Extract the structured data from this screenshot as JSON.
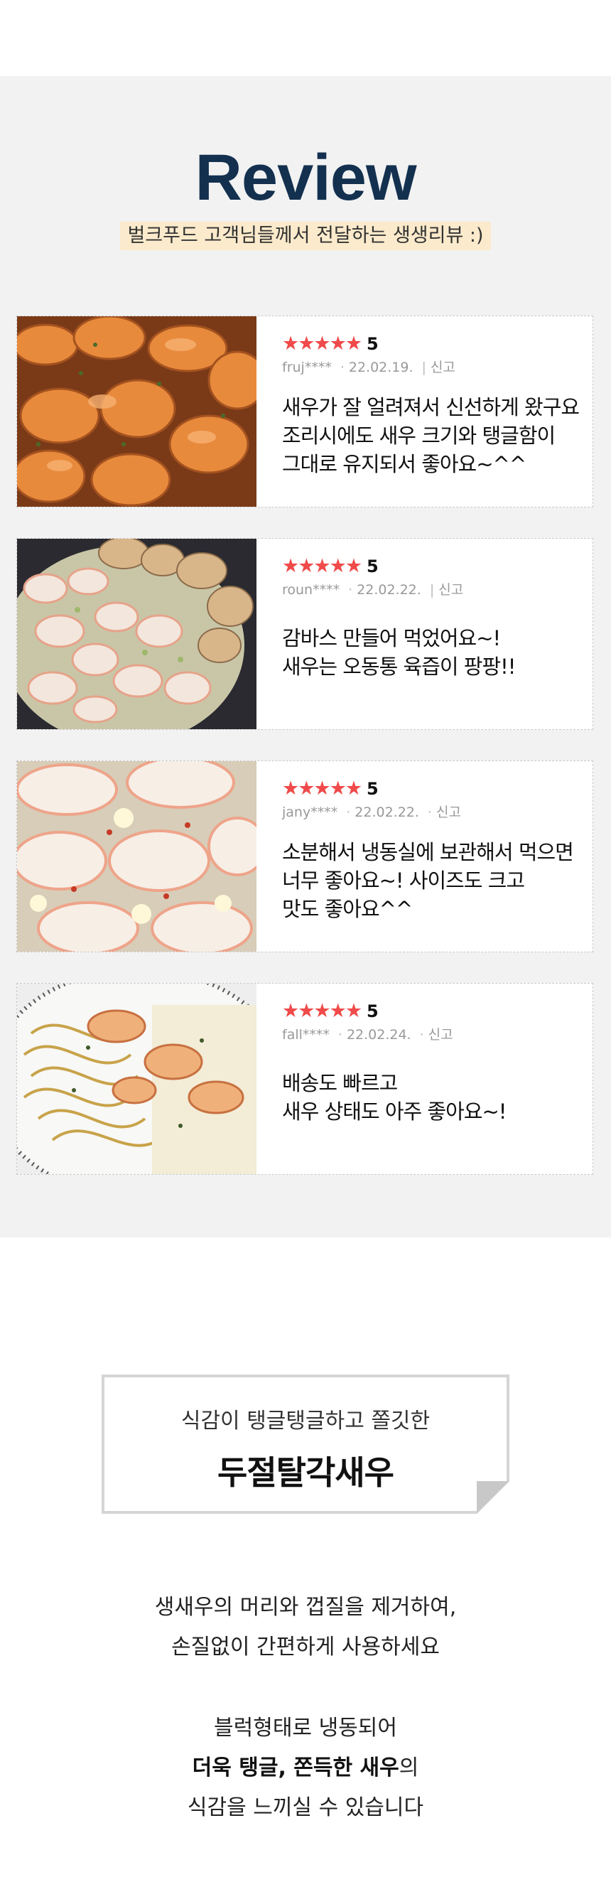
{
  "review": {
    "title": "Review",
    "subtitle": "벌크푸드 고객님들께서 전달하는 생생리뷰 :)",
    "items": [
      {
        "stars": "★★★★★",
        "rating": "5",
        "user": "fruj****",
        "date": "22.02.19.",
        "report": "신고",
        "lines": [
          "새우가 잘 얼려져서 신선하게 왔구요",
          "조리시에도 새우 크기와 탱글함이",
          "그대로 유지되서 좋아요~^^"
        ]
      },
      {
        "stars": "★★★★★",
        "rating": "5",
        "user": "roun****",
        "date": "22.02.22.",
        "report": "신고",
        "lines": [
          "감바스 만들어 먹었어요~!",
          "새우는 오동통 육즙이 팡팡!!"
        ]
      },
      {
        "stars": "★★★★★",
        "rating": "5",
        "user": "jany****",
        "date": "22.02.22.",
        "report": "신고",
        "lines": [
          "소분해서 냉동실에 보관해서 먹으면",
          "너무 좋아요~! 사이즈도 크고",
          "맛도 좋아요^^"
        ]
      },
      {
        "stars": "★★★★★",
        "rating": "5",
        "user": "fall****",
        "date": "22.02.24.",
        "report": "신고",
        "lines": [
          "배송도 빠르고",
          "새우 상태도 아주 좋아요~!"
        ]
      }
    ]
  },
  "feature": {
    "small": "식감이 탱글탱글하고 쫄깃한",
    "big": "두절탈각새우"
  },
  "description": {
    "p1_line1": "생새우의 머리와 껍질을 제거하여,",
    "p1_line2": "손질없이 간편하게 사용하세요",
    "p2_line1": "블럭형태로 냉동되어",
    "p2_line2_bold": "더욱 탱글, 쫀득한 새우",
    "p2_line2_rest": "의",
    "p2_line3": "식감을 느끼실 수 있습니다"
  },
  "colors": {
    "title": "#13304f",
    "star": "#f04a4a",
    "subtitle_highlight": "#fbeacb",
    "section_bg": "#f2f2f2"
  }
}
